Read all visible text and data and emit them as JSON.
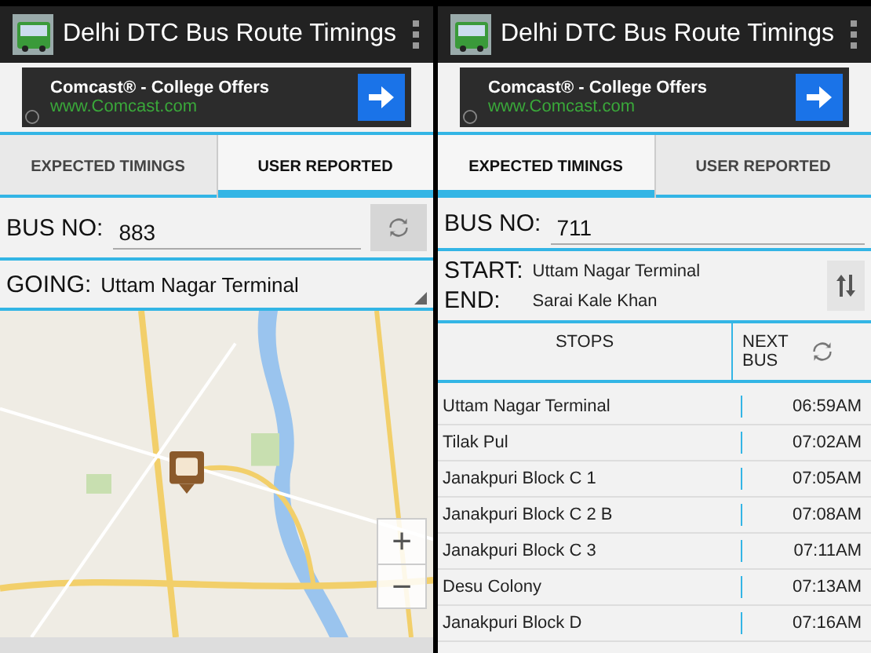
{
  "screens": [
    {
      "kind": "map",
      "app_title": "Delhi DTC Bus Route Timings",
      "ad": {
        "headline": "Comcast® - College Offers",
        "url": "www.Comcast.com"
      },
      "tabs": [
        {
          "label": "EXPECTED TIMINGS",
          "selected": false
        },
        {
          "label": "USER REPORTED",
          "selected": true
        }
      ],
      "bus_no": {
        "label": "BUS NO:",
        "value": "883"
      },
      "going": {
        "label": "GOING:",
        "value": "Uttam Nagar Terminal"
      },
      "map": {
        "zoom_in": "+",
        "zoom_out": "−"
      }
    },
    {
      "kind": "stops",
      "app_title": "Delhi DTC Bus Route Timings",
      "ad": {
        "headline": "Comcast® - College Offers",
        "url": "www.Comcast.com"
      },
      "tabs": [
        {
          "label": "EXPECTED TIMINGS",
          "selected": true
        },
        {
          "label": "USER REPORTED",
          "selected": false
        }
      ],
      "bus_no": {
        "label": "BUS NO:",
        "value": "711"
      },
      "route": {
        "start_label": "START:",
        "start": "Uttam Nagar Terminal",
        "end_label": "END:",
        "end": "Sarai Kale Khan"
      },
      "table": {
        "columns": [
          "STOPS",
          "NEXT BUS"
        ],
        "rows": [
          {
            "stop": "Uttam Nagar Terminal",
            "time": "06:59AM"
          },
          {
            "stop": "Tilak Pul",
            "time": "07:02AM"
          },
          {
            "stop": "Janakpuri Block C 1",
            "time": "07:05AM"
          },
          {
            "stop": "Janakpuri Block C 2 B",
            "time": "07:08AM"
          },
          {
            "stop": "Janakpuri Block C 3",
            "time": "07:11AM"
          },
          {
            "stop": "Desu Colony",
            "time": "07:13AM"
          },
          {
            "stop": "Janakpuri Block D",
            "time": "07:16AM"
          }
        ]
      }
    }
  ]
}
